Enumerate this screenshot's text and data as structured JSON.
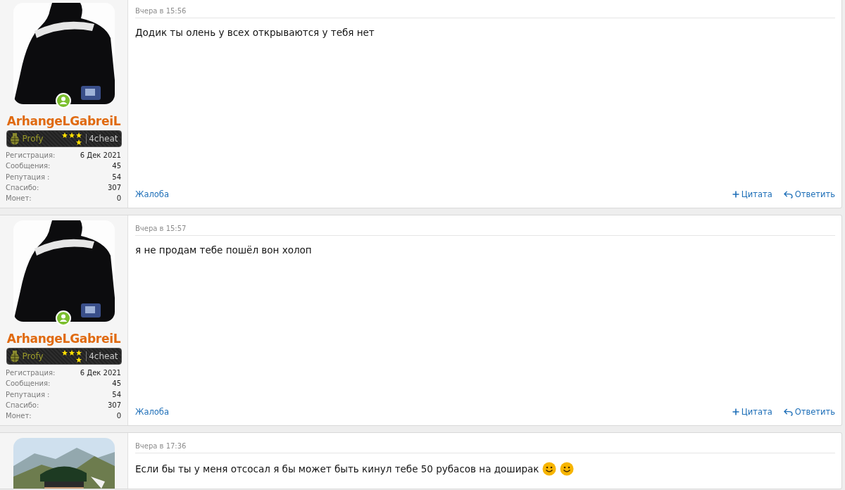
{
  "posts": [
    {
      "author": {
        "name": "ArhangeLGabreiL",
        "online": true,
        "rank": "Profy",
        "site": "4cheat",
        "stats": [
          {
            "label": "Регистрация:",
            "value": "6 Дек 2021"
          },
          {
            "label": "Сообщения:",
            "value": "45"
          },
          {
            "label": "Репутация :",
            "value": "54"
          },
          {
            "label": "Спасибо:",
            "value": "307"
          },
          {
            "label": "Монет:",
            "value": "0"
          }
        ]
      },
      "avatar": {
        "kind": "picture"
      },
      "time": "Вчера в 15:56",
      "text": "Додик ты олень у всех открываются у тебя нет",
      "actions": {
        "report": "Жалоба",
        "quote": "Цитата",
        "reply": "Ответить"
      }
    },
    {
      "author": {
        "name": "ArhangeLGabreiL",
        "online": true,
        "rank": "Profy",
        "site": "4cheat",
        "stats": [
          {
            "label": "Регистрация:",
            "value": "6 Дек 2021"
          },
          {
            "label": "Сообщения:",
            "value": "45"
          },
          {
            "label": "Репутация :",
            "value": "54"
          },
          {
            "label": "Спасибо:",
            "value": "307"
          },
          {
            "label": "Монет:",
            "value": "0"
          }
        ]
      },
      "avatar": {
        "kind": "picture"
      },
      "time": "Вчера в 15:57",
      "text": "я не продам тебе пошёл вон холоп",
      "actions": {
        "report": "Жалоба",
        "quote": "Цитата",
        "reply": "Ответить"
      }
    },
    {
      "avatar": {
        "kind": "picture"
      },
      "time": "Вчера в 17:36",
      "text": "Если бы ты у меня отсосал я бы может быть кинул тебе 50 рубасов на доширак",
      "emojis": [
        {
          "kind": "smiley"
        },
        {
          "kind": "smiley"
        }
      ]
    }
  ]
}
